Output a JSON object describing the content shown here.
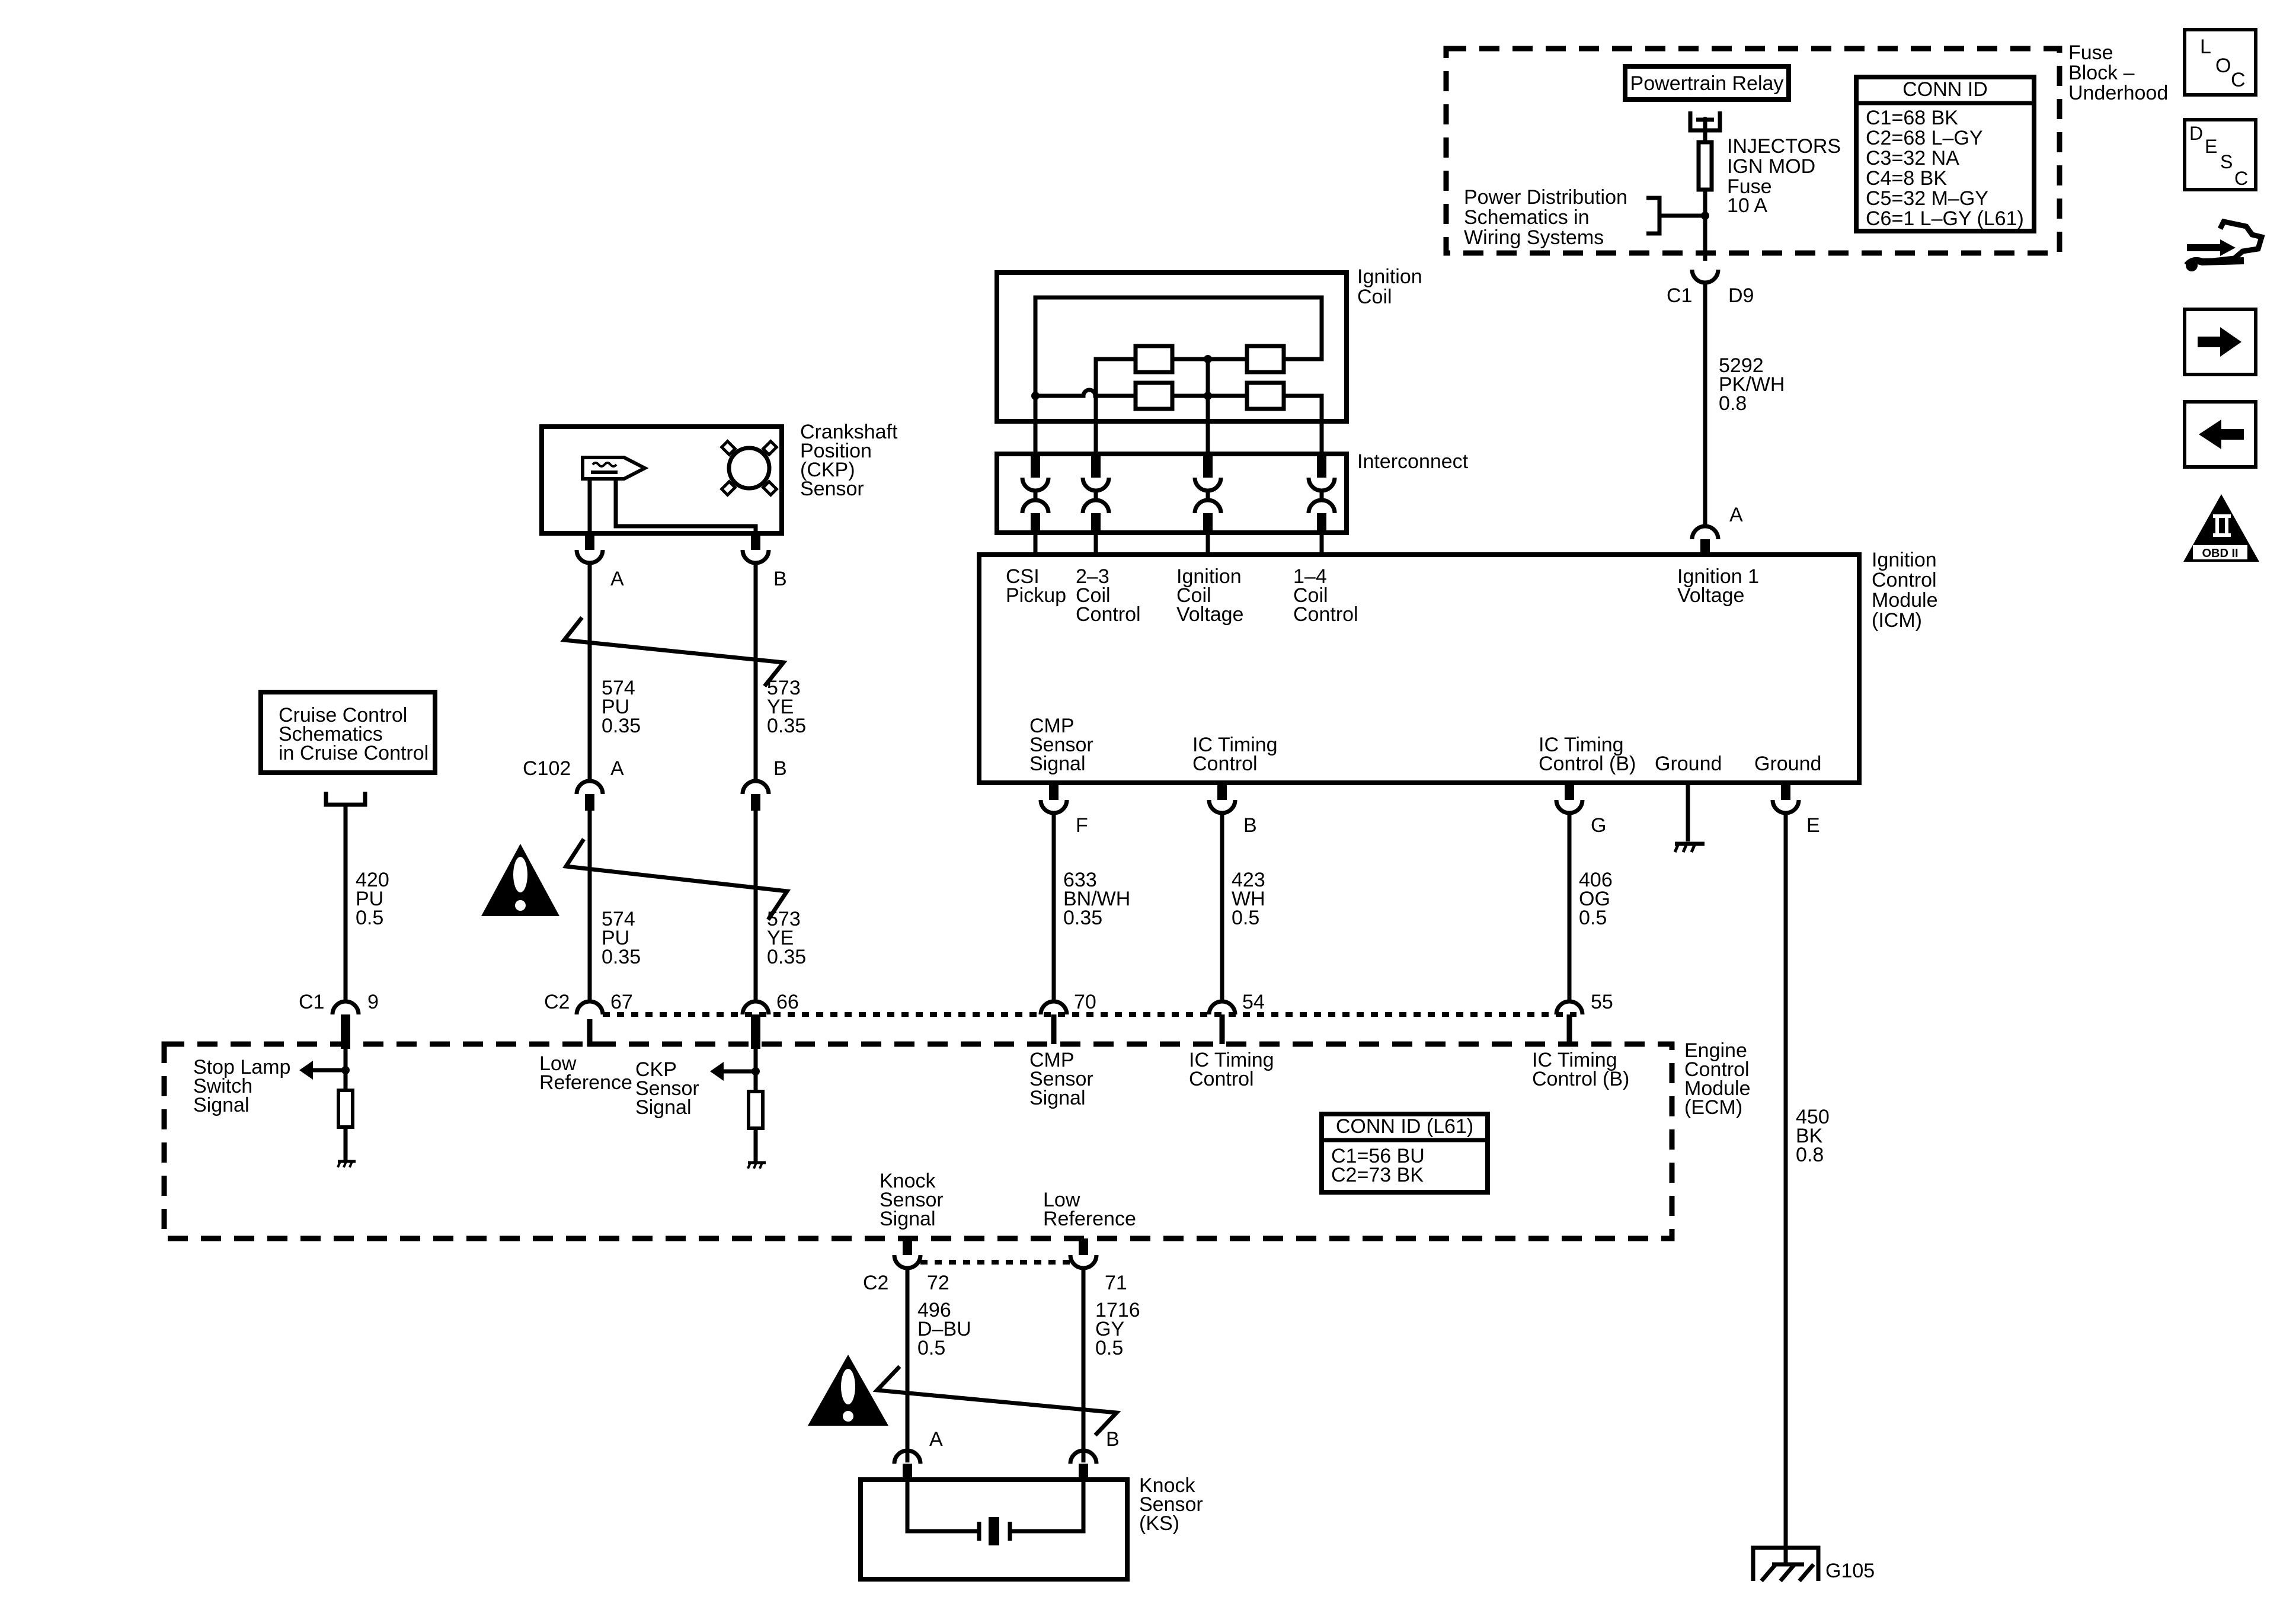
{
  "fuse_block": {
    "label": [
      "Fuse",
      "Block –",
      "Underhood"
    ],
    "relay": "Powertrain Relay",
    "fuse": [
      "INJECTORS",
      "IGN MOD",
      "Fuse",
      "10 A"
    ],
    "power_dist": [
      "Power Distribution",
      "Schematics in",
      "Wiring Systems"
    ],
    "conn_id": {
      "title": "CONN ID",
      "rows": [
        "C1=68 BK",
        "C2=68 L–GY",
        "C3=32 NA",
        "C4=8 BK",
        "C5=32 M–GY",
        "C6=1 L–GY (L61)"
      ]
    },
    "conn_left": "C1",
    "conn_right": "D9"
  },
  "wire_5292": [
    "5292",
    "PK/WH",
    "0.8"
  ],
  "ignition_coil": {
    "label": [
      "Ignition",
      "Coil"
    ]
  },
  "interconnect": {
    "label": "Interconnect"
  },
  "icm": {
    "label": [
      "Ignition",
      "Control",
      "Module",
      "(ICM)"
    ],
    "top_pins": [
      [
        "CSI",
        "Pickup"
      ],
      [
        "2–3",
        "Coil",
        "Control"
      ],
      [
        "Ignition",
        "Coil",
        "Voltage"
      ],
      [
        "1–4",
        "Coil",
        "Control"
      ],
      [
        "Ignition 1",
        "Voltage"
      ]
    ],
    "pin_a": "A",
    "bottom_pins": [
      {
        "text": [
          "CMP",
          "Sensor",
          "Signal"
        ],
        "pin": "F"
      },
      {
        "text": [
          "IC Timing",
          "Control"
        ],
        "pin": "B"
      },
      {
        "text": [
          "IC Timing",
          "Control (B)"
        ],
        "pin": "G"
      },
      {
        "text": [
          "Ground"
        ],
        "pin": ""
      },
      {
        "text": [
          "Ground"
        ],
        "pin": "E"
      }
    ]
  },
  "ckp": {
    "label": [
      "Crankshaft",
      "Position",
      "(CKP)",
      "Sensor"
    ],
    "pin_a": "A",
    "pin_b": "B",
    "wire_a_upper": [
      "574",
      "PU",
      "0.35"
    ],
    "wire_b_upper": [
      "573",
      "YE",
      "0.35"
    ],
    "c102": "C102",
    "c102_a": "A",
    "c102_b": "B",
    "wire_a_lower": [
      "574",
      "PU",
      "0.35"
    ],
    "wire_b_lower": [
      "573",
      "YE",
      "0.35"
    ]
  },
  "cruise": {
    "label": [
      "Cruise Control",
      "Schematics",
      "in Cruise Control"
    ],
    "wire": [
      "420",
      "PU",
      "0.5"
    ]
  },
  "wires_icm_ecm": [
    [
      "633",
      "BN/WH",
      "0.35"
    ],
    [
      "423",
      "WH",
      "0.5"
    ],
    [
      "406",
      "OG",
      "0.5"
    ]
  ],
  "wire_450": [
    "450",
    "BK",
    "0.8"
  ],
  "ecm": {
    "label": [
      "Engine",
      "Control",
      "Module",
      "(ECM)"
    ],
    "pins_top": {
      "c1": "C1",
      "p9": "9",
      "c2": "C2",
      "p67": "67",
      "p66": "66",
      "p70": "70",
      "p54": "54",
      "p55": "55"
    },
    "stop_lamp": [
      "Stop Lamp",
      "Switch",
      "Signal"
    ],
    "low_ref": [
      "Low",
      "Reference"
    ],
    "ckp_signal": [
      "CKP",
      "Sensor",
      "Signal"
    ],
    "cmp_signal": [
      "CMP",
      "Sensor",
      "Signal"
    ],
    "ic_timing": [
      "IC Timing",
      "Control"
    ],
    "ic_timing_b": [
      "IC Timing",
      "Control (B)"
    ],
    "conn_id": {
      "title": "CONN ID (L61)",
      "rows": [
        "C1=56 BU",
        "C2=73 BK"
      ]
    },
    "knock_signal": [
      "Knock",
      "Sensor",
      "Signal"
    ],
    "knock_low_ref": [
      "Low",
      "Reference"
    ]
  },
  "knock": {
    "c2": "C2",
    "p72": "72",
    "p71": "71",
    "wire_a": [
      "496",
      "D–BU",
      "0.5"
    ],
    "wire_b": [
      "1716",
      "GY",
      "0.5"
    ],
    "pin_a": "A",
    "pin_b": "B",
    "label": [
      "Knock",
      "Sensor",
      "(KS)"
    ]
  },
  "ground": {
    "label": "G105"
  },
  "nav": {
    "loc": [
      "L",
      "O",
      "C"
    ],
    "desc": [
      "D",
      "E",
      "S",
      "C"
    ],
    "obd": "OBD II",
    "obd_roman": "II"
  }
}
